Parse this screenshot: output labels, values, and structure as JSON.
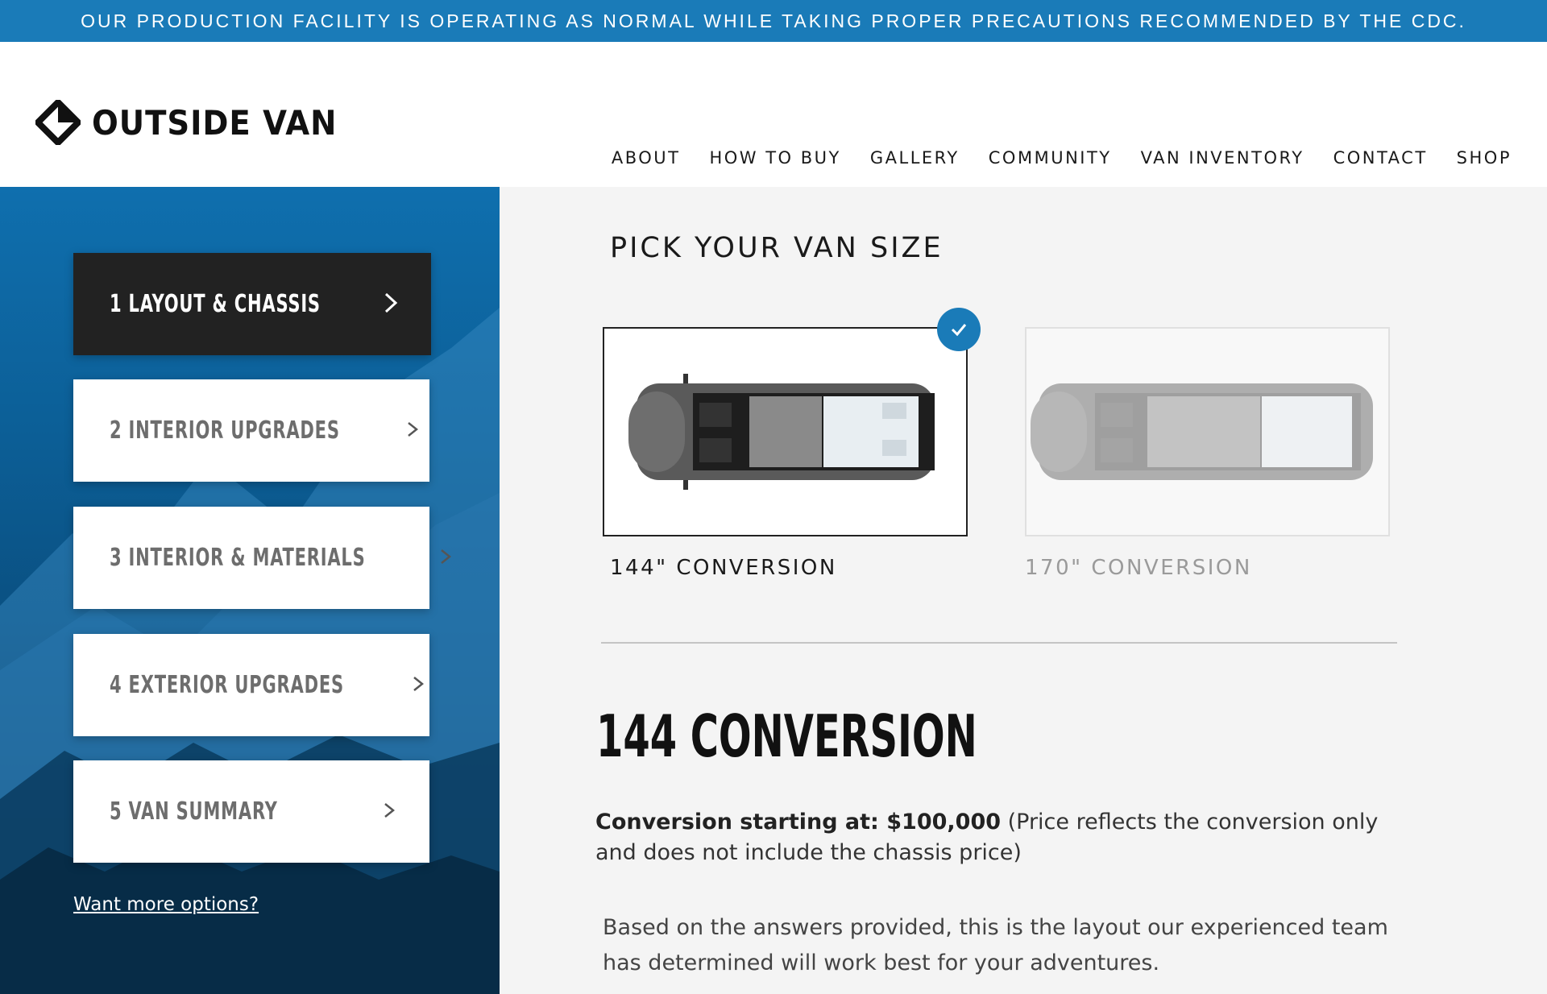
{
  "banner": {
    "text": "OUR PRODUCTION FACILITY IS OPERATING AS NORMAL WHILE TAKING PROPER PRECAUTIONS RECOMMENDED BY THE CDC."
  },
  "brand": {
    "name": "OUTSIDE VAN",
    "icon": "diamond-logo-icon"
  },
  "nav": {
    "items": [
      "ABOUT",
      "HOW TO BUY",
      "GALLERY",
      "COMMUNITY",
      "VAN INVENTORY",
      "CONTACT",
      "SHOP"
    ]
  },
  "steps": [
    {
      "label": "1 LAYOUT & CHASSIS",
      "active": true
    },
    {
      "label": "2 INTERIOR UPGRADES",
      "active": false
    },
    {
      "label": "3 INTERIOR & MATERIALS",
      "active": false
    },
    {
      "label": "4 EXTERIOR UPGRADES",
      "active": false
    },
    {
      "label": "5 VAN SUMMARY",
      "active": false
    }
  ],
  "sidebar": {
    "more_link": "Want more options?"
  },
  "main": {
    "pick_title": "PICK YOUR VAN SIZE",
    "options": [
      {
        "label": "144\" CONVERSION",
        "selected": true
      },
      {
        "label": "170\" CONVERSION",
        "selected": false
      }
    ],
    "conversion_title": "144 CONVERSION",
    "price_label": "Conversion starting at: $100,000",
    "price_note": " (Price reflects the conversion only and does not include the chassis price)",
    "description": "Based on the answers provided, this is the layout our experienced team has determined will work best for your adventures."
  },
  "colors": {
    "accent": "#1a7bb8",
    "active_step": "#222222"
  }
}
